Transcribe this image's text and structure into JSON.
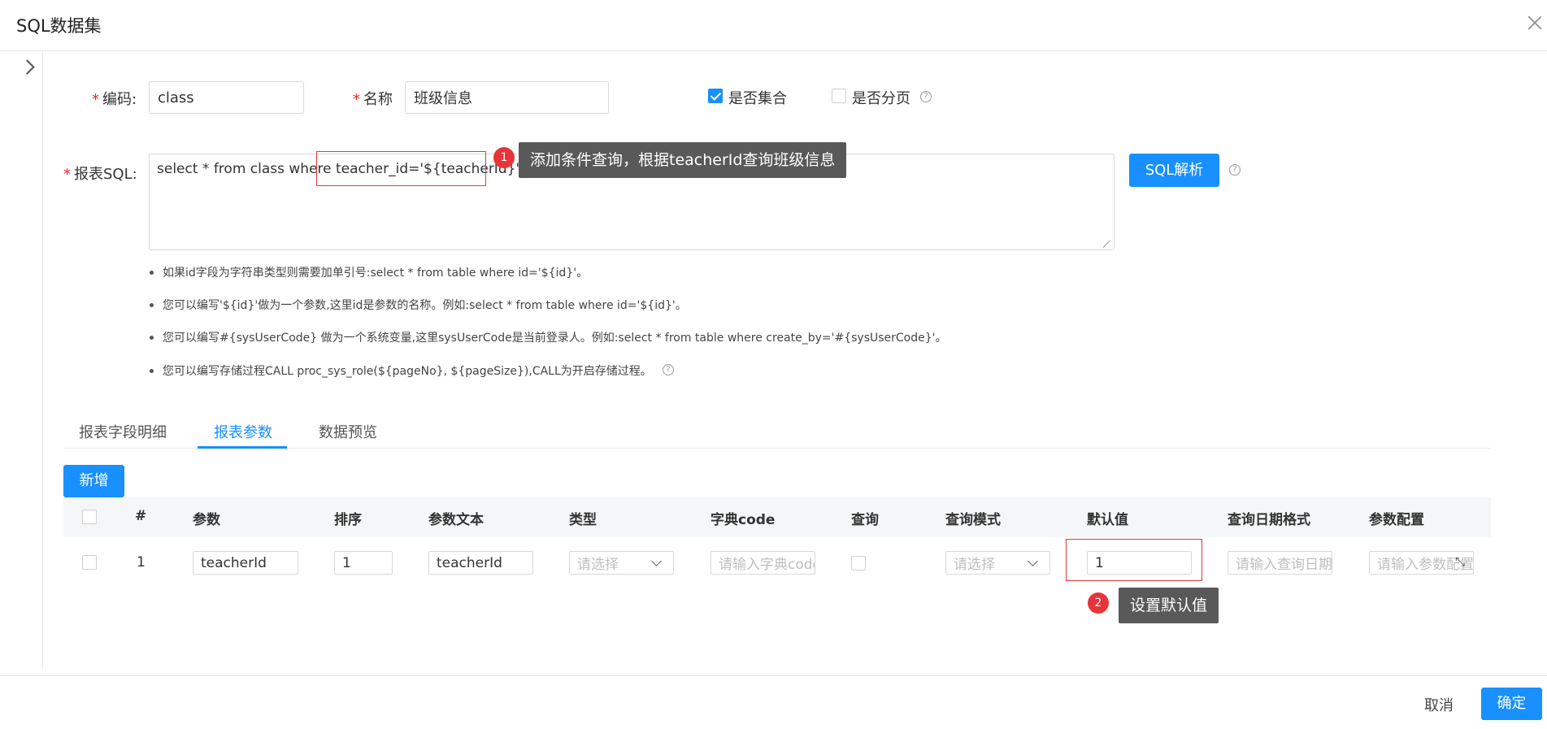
{
  "header": {
    "title": "SQL数据集"
  },
  "form": {
    "code_label": "编码:",
    "code_value": "class",
    "name_label": "名称",
    "name_value": "班级信息",
    "is_collection_label": "是否集合",
    "is_collection_checked": true,
    "is_paged_label": "是否分页",
    "is_paged_checked": false,
    "sql_label": "报表SQL:",
    "sql_prefix": "select * from class where ",
    "sql_highlight": "teacher_id='${teacherId}'",
    "parse_button": "SQL解析"
  },
  "annotations": {
    "badge1": "1",
    "tip1": "添加条件查询，根据teacherId查询班级信息",
    "badge2": "2",
    "tip2": "设置默认值"
  },
  "tips": [
    "如果id字段为字符串类型则需要加单引号:select * from table where id='${id}'。",
    "您可以编写'${id}'做为一个参数,这里id是参数的名称。例如:select * from table where id='${id}'。",
    "您可以编写#{sysUserCode} 做为一个系统变量,这里sysUserCode是当前登录人。例如:select * from table where create_by='#{sysUserCode}'。",
    "您可以编写存储过程CALL proc_sys_role(${pageNo}, ${pageSize}),CALL为开启存储过程。"
  ],
  "tabs": [
    {
      "label": "报表字段明细",
      "active": false
    },
    {
      "label": "报表参数",
      "active": true
    },
    {
      "label": "数据预览",
      "active": false
    }
  ],
  "add_button": "新增",
  "table": {
    "headers": [
      "#",
      "参数",
      "排序",
      "参数文本",
      "类型",
      "字典code",
      "查询",
      "查询模式",
      "默认值",
      "查询日期格式",
      "参数配置"
    ],
    "row": {
      "index": "1",
      "param": "teacherId",
      "order": "1",
      "param_text": "teacherId",
      "type_placeholder": "请选择",
      "dict_placeholder": "请输入字典code",
      "mode_placeholder": "请选择",
      "default_value": "1",
      "date_format_placeholder": "请输入查询日期格式",
      "config_placeholder": "请输入参数配置"
    }
  },
  "footer": {
    "cancel": "取消",
    "confirm": "确定"
  }
}
